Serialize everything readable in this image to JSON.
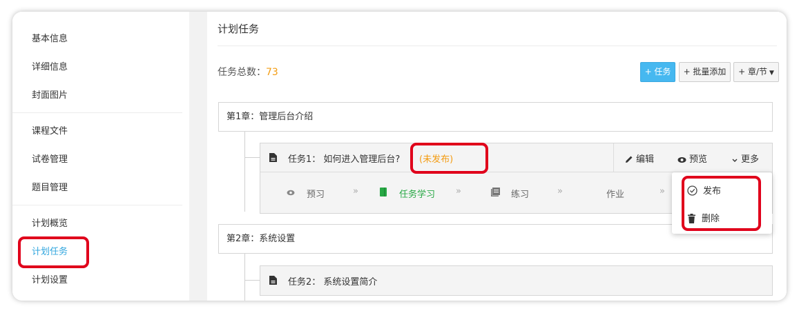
{
  "sidebar": {
    "items": [
      {
        "label": "基本信息"
      },
      {
        "label": "详细信息"
      },
      {
        "label": "封面图片"
      },
      {
        "label": "课程文件"
      },
      {
        "label": "试卷管理"
      },
      {
        "label": "题目管理"
      },
      {
        "label": "计划概览"
      },
      {
        "label": "计划任务",
        "active": true
      },
      {
        "label": "计划设置"
      }
    ]
  },
  "main": {
    "title": "计划任务",
    "total_label": "任务总数：",
    "total_count": "73",
    "buttons": {
      "add_task": "+ 任务",
      "batch_add": "+ 批量添加",
      "chapter": "+ 章/节"
    }
  },
  "chapters": [
    {
      "label": "第1章：管理后台介绍"
    },
    {
      "label": "第2章：系统设置"
    }
  ],
  "tasks": [
    {
      "title": "任务1：   如何进入管理后台?",
      "status": "(未发布)",
      "actions": {
        "edit": "编辑",
        "preview": "预览",
        "more": "更多"
      },
      "steps": [
        "预习",
        "任务学习",
        "练习",
        "作业"
      ]
    },
    {
      "title": "任务2：   系统设置简介"
    }
  ],
  "dropdown": {
    "publish": "发布",
    "delete": "删除"
  },
  "colors": {
    "accent": "#31a6de",
    "primary_button": "#46b8f0",
    "status_orange": "#f39c12",
    "step_green": "#27a844",
    "highlight_red": "#e0001b"
  }
}
